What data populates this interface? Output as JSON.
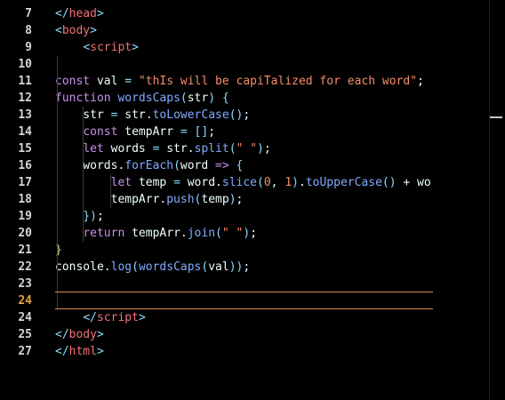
{
  "editor": {
    "language": "html",
    "active_line": 24,
    "lines": [
      {
        "n": "7",
        "segments": [
          {
            "c": "punct",
            "t": "</"
          },
          {
            "c": "tag",
            "t": "head"
          },
          {
            "c": "punct",
            "t": ">"
          }
        ]
      },
      {
        "n": "8",
        "segments": [
          {
            "c": "punct",
            "t": "<"
          },
          {
            "c": "tag",
            "t": "body"
          },
          {
            "c": "punct",
            "t": ">"
          }
        ]
      },
      {
        "n": "9",
        "segments": [
          {
            "c": "plain",
            "t": "    "
          },
          {
            "c": "punct",
            "t": "<"
          },
          {
            "c": "tag",
            "t": "script"
          },
          {
            "c": "punct",
            "t": ">"
          }
        ]
      },
      {
        "n": "10",
        "segments": []
      },
      {
        "n": "11",
        "segments": [
          {
            "c": "kw",
            "t": "const "
          },
          {
            "c": "var",
            "t": "val"
          },
          {
            "c": "punct",
            "t": " = "
          },
          {
            "c": "str",
            "t": "\"thIs will be capiTalized for each word\""
          },
          {
            "c": "plain",
            "t": ";"
          }
        ]
      },
      {
        "n": "12",
        "segments": [
          {
            "c": "kw",
            "t": "function "
          },
          {
            "c": "fn",
            "t": "wordsCaps"
          },
          {
            "c": "punct",
            "t": "("
          },
          {
            "c": "var",
            "t": "str"
          },
          {
            "c": "punct",
            "t": ")"
          },
          {
            "c": "plain",
            "t": " "
          },
          {
            "c": "punct",
            "t": "{"
          }
        ]
      },
      {
        "n": "13",
        "segments": [
          {
            "c": "plain",
            "t": "    str "
          },
          {
            "c": "punct",
            "t": "= "
          },
          {
            "c": "plain",
            "t": "str."
          },
          {
            "c": "fn",
            "t": "toLowerCase"
          },
          {
            "c": "punct",
            "t": "()"
          },
          {
            "c": "plain",
            "t": ";"
          }
        ]
      },
      {
        "n": "14",
        "segments": [
          {
            "c": "plain",
            "t": "    "
          },
          {
            "c": "kw",
            "t": "const "
          },
          {
            "c": "var",
            "t": "tempArr"
          },
          {
            "c": "punct",
            "t": " = []"
          },
          {
            "c": "plain",
            "t": ";"
          }
        ]
      },
      {
        "n": "15",
        "segments": [
          {
            "c": "plain",
            "t": "    "
          },
          {
            "c": "kw",
            "t": "let "
          },
          {
            "c": "var",
            "t": "words"
          },
          {
            "c": "punct",
            "t": " = "
          },
          {
            "c": "plain",
            "t": "str."
          },
          {
            "c": "fn",
            "t": "split"
          },
          {
            "c": "punct",
            "t": "("
          },
          {
            "c": "str",
            "t": "\" \""
          },
          {
            "c": "punct",
            "t": ")"
          },
          {
            "c": "plain",
            "t": ";"
          }
        ]
      },
      {
        "n": "16",
        "segments": [
          {
            "c": "plain",
            "t": "    words."
          },
          {
            "c": "fn",
            "t": "forEach"
          },
          {
            "c": "punct",
            "t": "("
          },
          {
            "c": "var",
            "t": "word"
          },
          {
            "c": "kw",
            "t": " => "
          },
          {
            "c": "punct",
            "t": "{"
          }
        ]
      },
      {
        "n": "17",
        "segments": [
          {
            "c": "plain",
            "t": "        "
          },
          {
            "c": "kw",
            "t": "let "
          },
          {
            "c": "var",
            "t": "temp"
          },
          {
            "c": "punct",
            "t": " = "
          },
          {
            "c": "plain",
            "t": "word."
          },
          {
            "c": "fn",
            "t": "slice"
          },
          {
            "c": "punct",
            "t": "("
          },
          {
            "c": "num",
            "t": "0"
          },
          {
            "c": "plain",
            "t": ", "
          },
          {
            "c": "num",
            "t": "1"
          },
          {
            "c": "punct",
            "t": ")"
          },
          {
            "c": "plain",
            "t": "."
          },
          {
            "c": "fn",
            "t": "toUpperCase"
          },
          {
            "c": "punct",
            "t": "()"
          },
          {
            "c": "plain",
            "t": " + word"
          }
        ]
      },
      {
        "n": "18",
        "segments": [
          {
            "c": "plain",
            "t": "        tempArr."
          },
          {
            "c": "fn",
            "t": "push"
          },
          {
            "c": "punct",
            "t": "("
          },
          {
            "c": "plain",
            "t": "temp"
          },
          {
            "c": "punct",
            "t": ")"
          },
          {
            "c": "plain",
            "t": ";"
          }
        ]
      },
      {
        "n": "19",
        "segments": [
          {
            "c": "plain",
            "t": "    "
          },
          {
            "c": "punct",
            "t": "})"
          },
          {
            "c": "plain",
            "t": ";"
          }
        ]
      },
      {
        "n": "20",
        "segments": [
          {
            "c": "plain",
            "t": "    "
          },
          {
            "c": "kw",
            "t": "return "
          },
          {
            "c": "plain",
            "t": "tempArr."
          },
          {
            "c": "fn",
            "t": "join"
          },
          {
            "c": "punct",
            "t": "("
          },
          {
            "c": "str",
            "t": "\" \""
          },
          {
            "c": "punct",
            "t": ")"
          },
          {
            "c": "plain",
            "t": ";"
          }
        ]
      },
      {
        "n": "21",
        "segments": [
          {
            "c": "method",
            "t": "}"
          }
        ]
      },
      {
        "n": "22",
        "segments": [
          {
            "c": "plain",
            "t": "console."
          },
          {
            "c": "fn",
            "t": "log"
          },
          {
            "c": "punct",
            "t": "("
          },
          {
            "c": "fn",
            "t": "wordsCaps"
          },
          {
            "c": "punct",
            "t": "("
          },
          {
            "c": "plain",
            "t": "val"
          },
          {
            "c": "punct",
            "t": "))"
          },
          {
            "c": "plain",
            "t": ";"
          }
        ]
      },
      {
        "n": "23",
        "segments": []
      },
      {
        "n": "24",
        "segments": []
      },
      {
        "n": "24",
        "segments": [
          {
            "c": "plain",
            "t": "    "
          },
          {
            "c": "punct",
            "t": "</"
          },
          {
            "c": "tag",
            "t": "script"
          },
          {
            "c": "punct",
            "t": ">"
          }
        ]
      },
      {
        "n": "25",
        "segments": [
          {
            "c": "punct",
            "t": "</"
          },
          {
            "c": "tag",
            "t": "body"
          },
          {
            "c": "punct",
            "t": ">"
          }
        ]
      },
      {
        "n": "27",
        "segments": [
          {
            "c": "punct",
            "t": "</"
          },
          {
            "c": "tag",
            "t": "html"
          },
          {
            "c": "punct",
            "t": ">"
          }
        ]
      }
    ]
  },
  "colors": {
    "background": "#000000",
    "line_number": "#d4d4d4",
    "active_line_number": "#e9a23b",
    "current_line_border": "#e08a4e"
  }
}
